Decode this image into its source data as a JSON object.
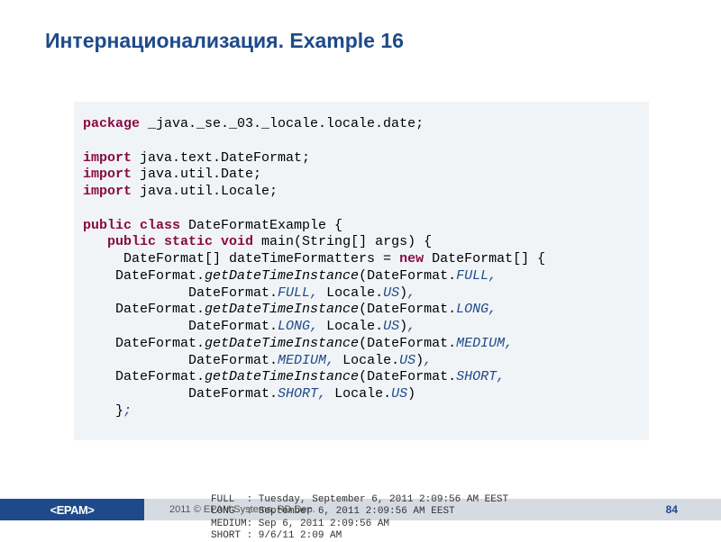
{
  "title": "Интернационализация. Example 16",
  "code": {
    "kw_package": "package",
    "pkg_path": " _java._se._03._locale.locale.date;",
    "kw_import1": "import",
    "imp1": " java.text.DateFormat;",
    "kw_import2": "import",
    "imp2": " java.util.Date;",
    "kw_import3": "import",
    "imp3": " java.util.Locale;",
    "kw_public_class": "public class",
    "class_decl": " DateFormatExample {",
    "kw_public_static_void": "public static void",
    "main_sig": " main(String[] args) {",
    "line_arr1": "     DateFormat[] dateTimeFormatters = ",
    "kw_new": "new",
    "line_arr2": " DateFormat[] {",
    "pref_df": "    DateFormat.",
    "m_gdti": "getDateTimeInstance",
    "open_df": "(DateFormat.",
    "c_full": "FULL",
    "comma": ",",
    "pref_df2": "             DateFormat.",
    "mid_locale": " Locale.",
    "c_us": "US",
    "close_paren": ")",
    "c_long": "LONG",
    "c_medium": "MEDIUM",
    "c_short": "SHORT",
    "end_brace": "    }",
    "semi": ";"
  },
  "footer": {
    "logo": "<EPAM>",
    "copy": "2011 © EPAM Systems, RD Dep.",
    "page": "84"
  },
  "overflow": "FULL  : Tuesday, September 6, 2011 2:09:56 AM EEST\nLONG  : September 6, 2011 2:09:56 AM EEST\nMEDIUM: Sep 6, 2011 2:09:56 AM\nSHORT : 9/6/11 2:09 AM"
}
